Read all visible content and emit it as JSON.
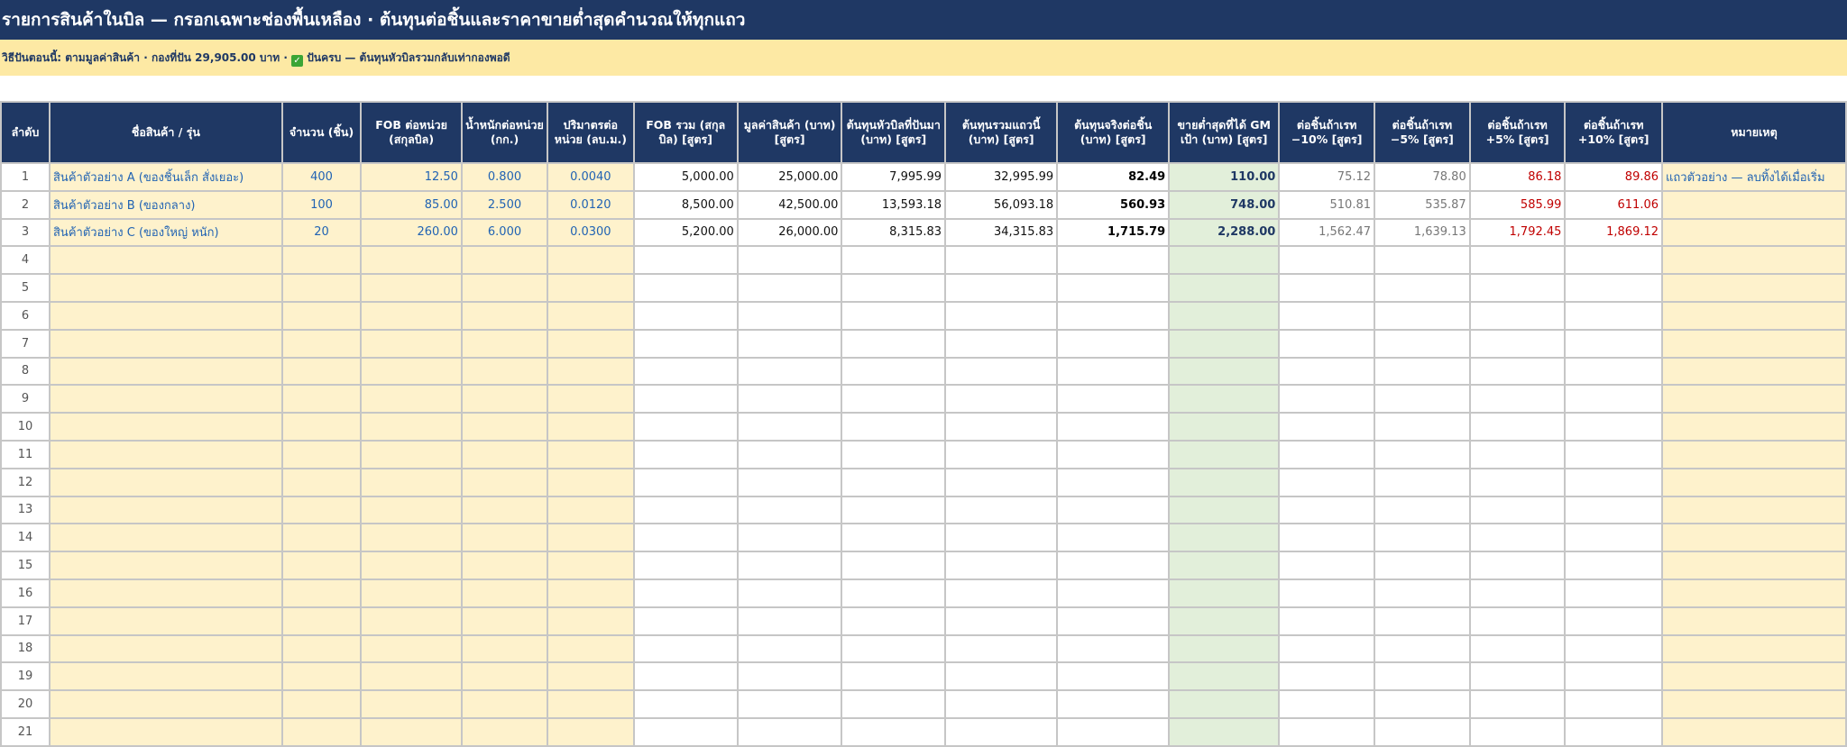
{
  "title": "รายการสินค้าในบิล — กรอกเฉพาะช่องพื้นเหลือง · ต้นทุนต่อชิ้นและราคาขายต่ำสุดคำนวณให้ทุกแถว",
  "info": {
    "text": "วิธีปันตอนนี้: ตามมูลค่าสินค้า · กองที่ปัน 29,905.00 บาท · ",
    "check_icon": "✓",
    "status": " ปันครบ — ต้นทุนหัวบิลรวมกลับเท่ากองพอดี"
  },
  "headers": [
    "ลำดับ",
    "ชื่อสินค้า / รุ่น",
    "จำนวน (ชิ้น)",
    "FOB ต่อหน่วย (สกุลบิล)",
    "น้ำหนักต่อหน่วย (กก.)",
    "ปริมาตรต่อหน่วย (ลบ.ม.)",
    "FOB รวม (สกุลบิล) [สูตร]",
    "มูลค่าสินค้า (บาท) [สูตร]",
    "ต้นทุนหัวบิลที่ปันมา (บาท) [สูตร]",
    "ต้นทุนรวมแถวนี้ (บาท) [สูตร]",
    "ต้นทุนจริงต่อชิ้น (บาท) [สูตร]",
    "ขายต่ำสุดที่ได้ GM เป้า (บาท) [สูตร]",
    "ต่อชิ้นถ้าเรท −10% [สูตร]",
    "ต่อชิ้นถ้าเรท −5% [สูตร]",
    "ต่อชิ้นถ้าเรท +5% [สูตร]",
    "ต่อชิ้นถ้าเรท +10% [สูตร]",
    "หมายเหตุ"
  ],
  "rows": [
    {
      "no": "1",
      "name": "สินค้าตัวอย่าง A (ของชิ้นเล็ก สั่งเยอะ)",
      "qty": "400",
      "fob": "12.50",
      "weight": "0.800",
      "volume": "0.0040",
      "fob_total": "5,000.00",
      "value": "25,000.00",
      "alloc": "7,995.99",
      "row_cost": "32,995.99",
      "unit_cost": "82.49",
      "min_price": "110.00",
      "m10": "75.12",
      "m5": "78.80",
      "p5": "86.18",
      "p10": "89.86",
      "note": "แถวตัวอย่าง — ลบทิ้งได้เมื่อเริ่ม"
    },
    {
      "no": "2",
      "name": "สินค้าตัวอย่าง B (ของกลาง)",
      "qty": "100",
      "fob": "85.00",
      "weight": "2.500",
      "volume": "0.0120",
      "fob_total": "8,500.00",
      "value": "42,500.00",
      "alloc": "13,593.18",
      "row_cost": "56,093.18",
      "unit_cost": "560.93",
      "min_price": "748.00",
      "m10": "510.81",
      "m5": "535.87",
      "p5": "585.99",
      "p10": "611.06",
      "note": ""
    },
    {
      "no": "3",
      "name": "สินค้าตัวอย่าง C (ของใหญ่ หนัก)",
      "qty": "20",
      "fob": "260.00",
      "weight": "6.000",
      "volume": "0.0300",
      "fob_total": "5,200.00",
      "value": "26,000.00",
      "alloc": "8,315.83",
      "row_cost": "34,315.83",
      "unit_cost": "1,715.79",
      "min_price": "2,288.00",
      "m10": "1,562.47",
      "m5": "1,639.13",
      "p5": "1,792.45",
      "p10": "1,869.12",
      "note": ""
    },
    {
      "no": "4"
    },
    {
      "no": "5"
    },
    {
      "no": "6"
    },
    {
      "no": "7"
    },
    {
      "no": "8"
    },
    {
      "no": "9"
    },
    {
      "no": "10"
    },
    {
      "no": "11"
    },
    {
      "no": "12"
    },
    {
      "no": "13"
    },
    {
      "no": "14"
    },
    {
      "no": "15"
    },
    {
      "no": "16"
    },
    {
      "no": "17"
    },
    {
      "no": "18"
    },
    {
      "no": "19"
    },
    {
      "no": "20"
    },
    {
      "no": "21"
    }
  ]
}
